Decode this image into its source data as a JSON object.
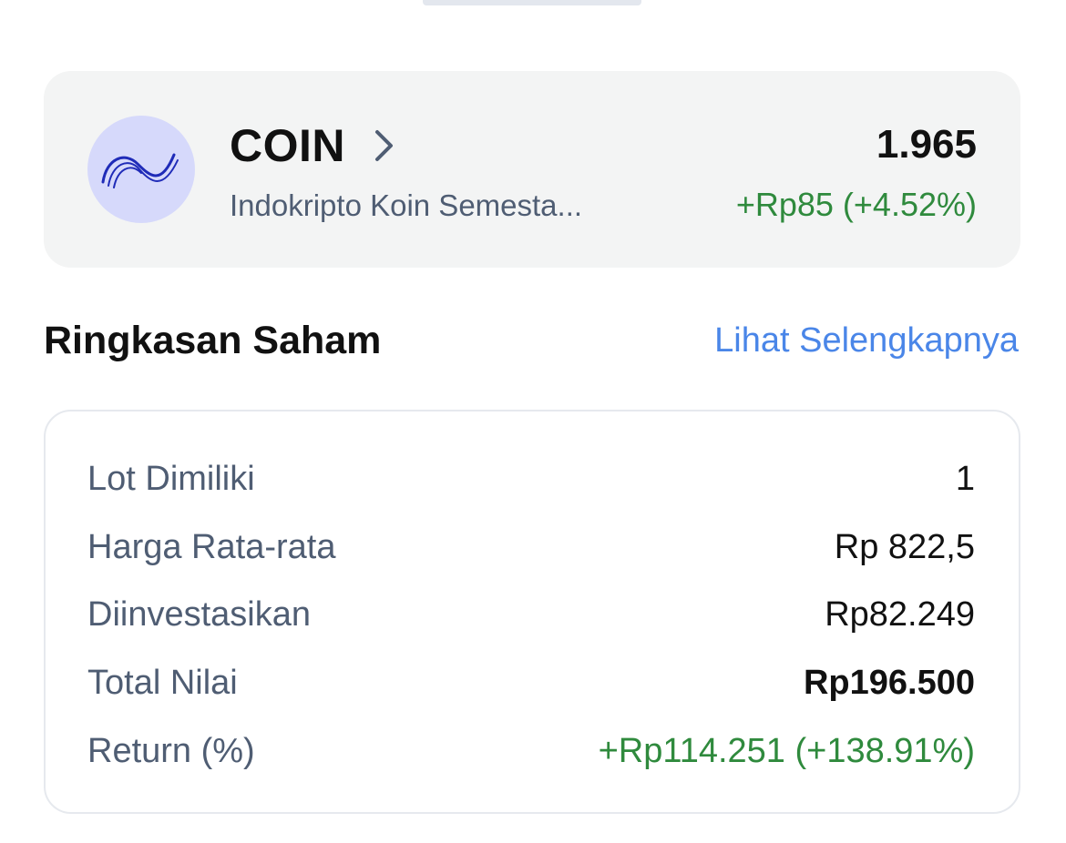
{
  "stock": {
    "logo_icon": "indokripto-wave-logo-icon",
    "ticker": "COIN",
    "chevron_icon": "chevron-right-icon",
    "company_name": "Indokripto Koin Semesta...",
    "price": "1.965",
    "change": "+Rp85 (+4.52%)"
  },
  "summary_section": {
    "title": "Ringkasan Saham",
    "see_more_label": "Lihat Selengkapnya"
  },
  "summary": {
    "rows": [
      {
        "label": "Lot Dimiliki",
        "value": "1"
      },
      {
        "label": "Harga Rata-rata",
        "value": "Rp 822,5"
      },
      {
        "label": "Diinvestasikan",
        "value": "Rp82.249"
      },
      {
        "label": "Total Nilai",
        "value": "Rp196.500"
      },
      {
        "label": "Return (%)",
        "value": "+Rp114.251 (+138.91%)"
      }
    ]
  },
  "colors": {
    "positive": "#2f8a3d",
    "link": "#4a86e8",
    "logo_bg": "#d6d9fb",
    "logo_stroke": "#1f2bb8"
  }
}
